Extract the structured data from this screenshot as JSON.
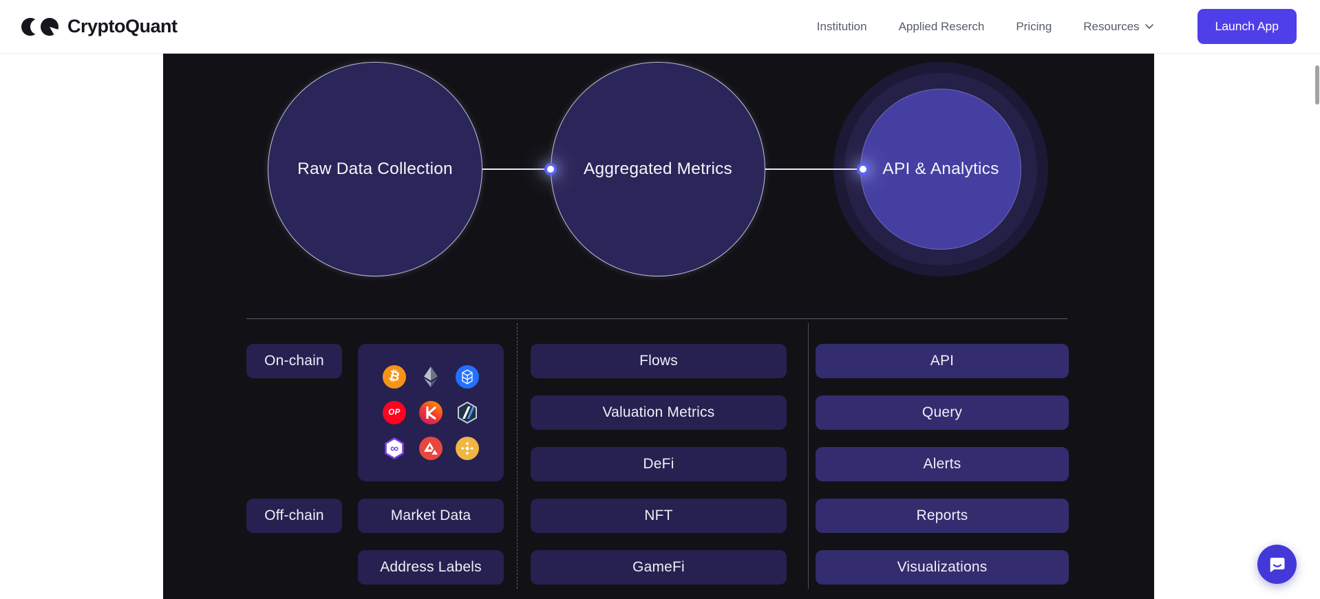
{
  "header": {
    "logo_text": "CryptoQuant",
    "nav": {
      "items": [
        {
          "label": "Institution"
        },
        {
          "label": "Applied Reserch"
        },
        {
          "label": "Pricing"
        },
        {
          "label": "Resources",
          "has_dropdown": true
        }
      ]
    },
    "launch_button_label": "Launch App"
  },
  "pipeline": {
    "stages": [
      {
        "label": "Raw Data Collection"
      },
      {
        "label": "Aggregated Metrics"
      },
      {
        "label": "API & Analytics"
      }
    ]
  },
  "sources": {
    "on_chain_label": "On-chain",
    "off_chain_label": "Off-chain",
    "market_data_label": "Market Data",
    "address_labels_label": "Address Labels",
    "chains": [
      {
        "name": "Bitcoin",
        "symbol": "₿"
      },
      {
        "name": "Ethereum"
      },
      {
        "name": "Fantom"
      },
      {
        "name": "Optimism",
        "symbol": "OP"
      },
      {
        "name": "Klaytn"
      },
      {
        "name": "Arbitrum"
      },
      {
        "name": "Polygon",
        "symbol": "∞"
      },
      {
        "name": "Avalanche"
      },
      {
        "name": "BNB Chain"
      }
    ]
  },
  "metrics": {
    "items": [
      {
        "label": "Flows"
      },
      {
        "label": "Valuation Metrics"
      },
      {
        "label": "DeFi"
      },
      {
        "label": "NFT"
      },
      {
        "label": "GameFi"
      }
    ]
  },
  "products": {
    "items": [
      {
        "label": "API"
      },
      {
        "label": "Query"
      },
      {
        "label": "Alerts"
      },
      {
        "label": "Reports"
      },
      {
        "label": "Visualizations"
      }
    ]
  },
  "colors": {
    "accent": "#4f3fe8",
    "panel_bg": "#121116",
    "circle_fill": "#2b2659",
    "inner_circle_fill": "#453fa2",
    "chip_dark": "#262150",
    "chip_light": "#332c6e",
    "intercom": "#4438d8",
    "bitcoin": "#f7931a",
    "optimism": "#ff0420",
    "fantom": "#2470ff",
    "avalanche": "#e8473f",
    "bnb": "#f0b544",
    "polygon": "#7b3fe4"
  }
}
